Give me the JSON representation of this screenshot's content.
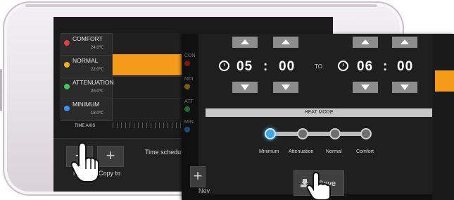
{
  "schedule": {
    "rows": [
      {
        "label": "COMFORT",
        "temp": "24.0℃",
        "color": "#e33b3b"
      },
      {
        "label": "NORMAL",
        "temp": "22.0℃",
        "color": "#f2b01b"
      },
      {
        "label": "ATTENUATION",
        "temp": "20.0℃",
        "color": "#3cc85a"
      },
      {
        "label": "MINIMUM",
        "temp": "18.0℃",
        "color": "#3a8ff0"
      }
    ],
    "time_axis_label": "TIME AXIS"
  },
  "bottom": {
    "new_label": "Ne",
    "copy_label": "Copy to",
    "schedule_label": "Time schedule",
    "new_label_right": "Nev"
  },
  "modal": {
    "side_hints": [
      "CON",
      "NOI",
      "ATT",
      "MIN",
      "TI"
    ],
    "time_from": {
      "hours": "05",
      "minutes": "00"
    },
    "to_label": "TO",
    "time_to": {
      "hours": "06",
      "minutes": "00"
    },
    "heat_mode_title": "HEAT MODE",
    "modes": [
      "Minimum",
      "Attenuation",
      "Normal",
      "Comfort"
    ],
    "selected_mode": "Minimum",
    "save_label": "Save"
  }
}
